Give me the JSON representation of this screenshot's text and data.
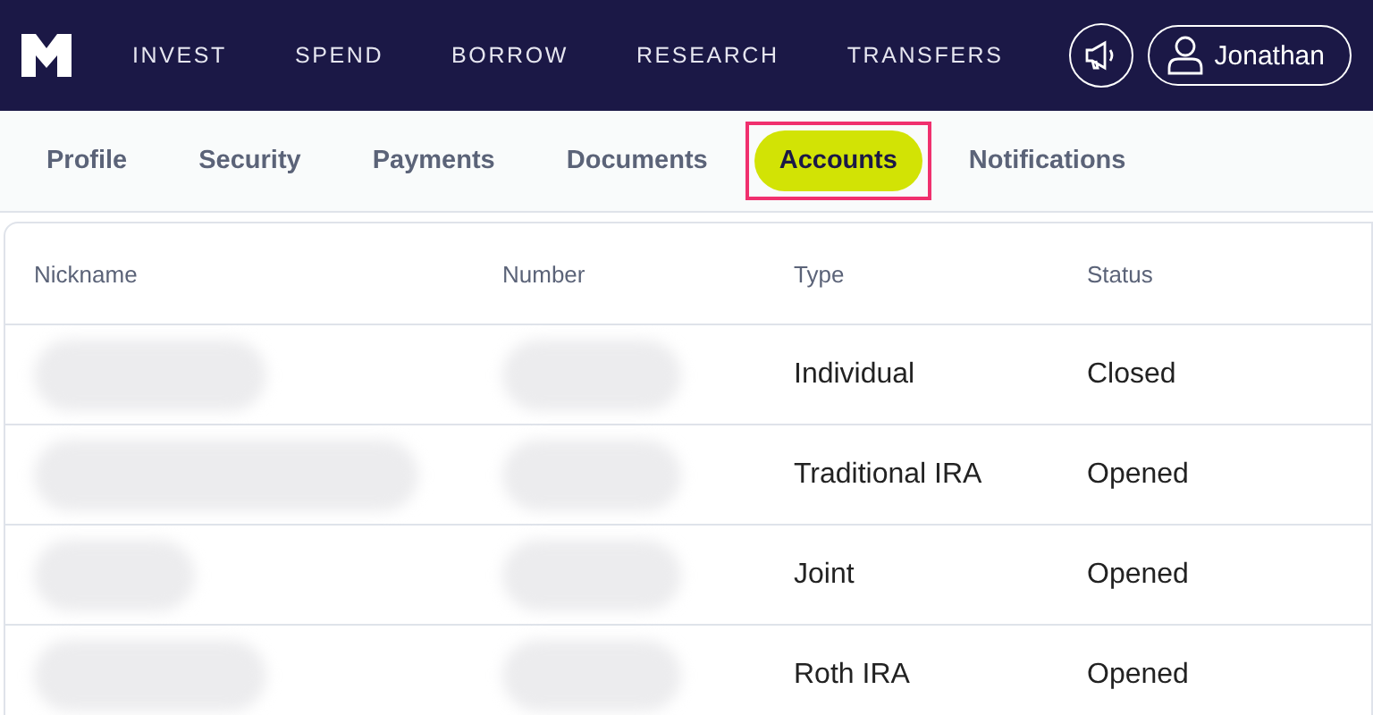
{
  "nav": {
    "items": [
      "INVEST",
      "SPEND",
      "BORROW",
      "RESEARCH",
      "TRANSFERS"
    ],
    "user": "Jonathan"
  },
  "tabs": [
    {
      "label": "Profile",
      "selected": false,
      "highlighted": false
    },
    {
      "label": "Security",
      "selected": false,
      "highlighted": false
    },
    {
      "label": "Payments",
      "selected": false,
      "highlighted": false
    },
    {
      "label": "Documents",
      "selected": false,
      "highlighted": false
    },
    {
      "label": "Accounts",
      "selected": true,
      "highlighted": true
    },
    {
      "label": "Notifications",
      "selected": false,
      "highlighted": false
    }
  ],
  "table": {
    "columns": [
      "Nickname",
      "Number",
      "Type",
      "Status"
    ],
    "rows": [
      {
        "nickname_redacted": true,
        "number_redacted": true,
        "type": "Individual",
        "status": "Closed"
      },
      {
        "nickname_redacted": true,
        "number_redacted": true,
        "type": "Traditional IRA",
        "status": "Opened"
      },
      {
        "nickname_redacted": true,
        "number_redacted": true,
        "type": "Joint",
        "status": "Opened"
      },
      {
        "nickname_redacted": true,
        "number_redacted": true,
        "type": "Roth IRA",
        "status": "Opened"
      }
    ]
  }
}
